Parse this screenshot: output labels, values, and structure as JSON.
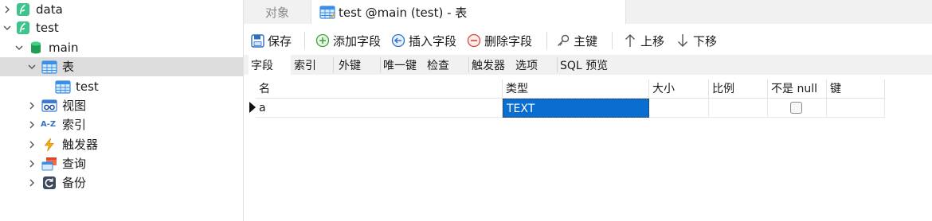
{
  "tree": {
    "items": [
      {
        "label": "data",
        "icon": "sqlite-file-icon"
      },
      {
        "label": "test",
        "icon": "sqlite-file-icon"
      },
      {
        "label": "main",
        "icon": "database-icon"
      },
      {
        "label": "表",
        "icon": "tables-icon"
      },
      {
        "label": "test",
        "icon": "table-icon"
      },
      {
        "label": "视图",
        "icon": "views-icon"
      },
      {
        "label": "索引",
        "icon": "index-icon"
      },
      {
        "label": "触发器",
        "icon": "trigger-icon"
      },
      {
        "label": "查询",
        "icon": "query-icon"
      },
      {
        "label": "备份",
        "icon": "backup-icon"
      }
    ],
    "index_icon_text": "A-Z"
  },
  "tabs": {
    "objects_label": "对象",
    "table_label": "test @main (test) - 表"
  },
  "toolbar": {
    "save_label": "保存",
    "add_field_label": "添加字段",
    "insert_field_label": "插入字段",
    "delete_field_label": "删除字段",
    "primary_key_label": "主键",
    "move_up_label": "上移",
    "move_down_label": "下移"
  },
  "subtabs": [
    "字段",
    "索引",
    "外键",
    "唯一键",
    "检查",
    "触发器",
    "选项",
    "SQL 预览"
  ],
  "grid": {
    "columns": [
      "名",
      "类型",
      "大小",
      "比例",
      "不是 null",
      "键"
    ],
    "rows": [
      {
        "name": "a",
        "type": "TEXT",
        "size": "",
        "scale": "",
        "not_null": false,
        "key": ""
      }
    ]
  },
  "colors": {
    "accent": "#0a6ed1",
    "sqlite_green": "#3cc48c",
    "database_green": "#1f9d55",
    "table_blue": "#3a8ee6",
    "selected_row": "#dcdcdc"
  }
}
